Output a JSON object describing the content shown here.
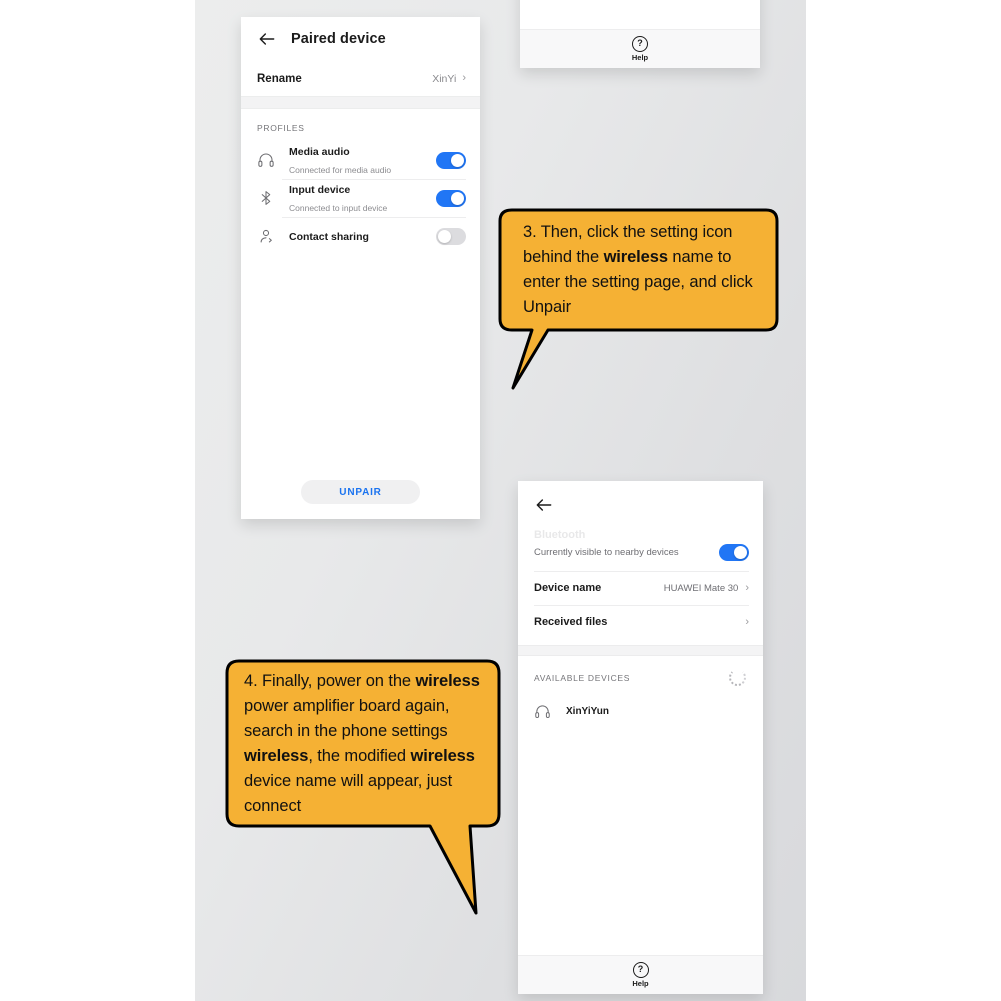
{
  "canvas": {
    "background_start": "#eceded",
    "background_end": "#d8d9dc"
  },
  "phone_paired_device": {
    "header": {
      "back_icon": "arrow-left-icon",
      "title": "Paired device"
    },
    "rename": {
      "label": "Rename",
      "value": "XinYi",
      "chevron": "›"
    },
    "profiles": {
      "section_title": "PROFILES",
      "rows": [
        {
          "icon": "headphones-icon",
          "title": "Media audio",
          "subtitle": "Connected for media audio",
          "toggle": "on"
        },
        {
          "icon": "bluetooth-icon",
          "title": "Input device",
          "subtitle": "Connected to input device",
          "toggle": "on"
        },
        {
          "icon": "contact-icon",
          "title": "Contact sharing",
          "subtitle": "",
          "toggle": "off"
        }
      ]
    },
    "unpair_button": {
      "label": "UNPAIR",
      "text_color": "#1a73f0",
      "background": "#f0f0f1"
    },
    "toggle_on_color": "#2176f5",
    "toggle_off_color": "#dcdcdf"
  },
  "phone_top_fragment": {
    "help": {
      "icon": "question-circle-icon",
      "glyph": "?",
      "label": "Help"
    }
  },
  "phone_bluetooth": {
    "header": {
      "back_icon": "arrow-left-icon"
    },
    "ghost_title": "Bluetooth",
    "visible_row": {
      "label": "Currently visible to nearby devices",
      "toggle": "on"
    },
    "rows": [
      {
        "label": "Device name",
        "value": "HUAWEI Mate 30",
        "chevron": "›"
      },
      {
        "label": "Received files",
        "value": "",
        "chevron": "›"
      }
    ],
    "available": {
      "section_title": "AVAILABLE DEVICES",
      "spinner": "loading-spinner-icon",
      "devices": [
        {
          "icon": "headphones-icon",
          "name": "XinYiYun"
        }
      ]
    },
    "help": {
      "icon": "question-circle-icon",
      "glyph": "?",
      "label": "Help"
    }
  },
  "callouts": {
    "fill": "#F5B134",
    "stroke": "#000000",
    "step3": {
      "line1_a": "3. Then, click the setting icon",
      "line2_a": "behind the ",
      "line2_b": "wireless",
      "line2_c": " name to",
      "line3_a": "enter the setting page, and click",
      "line4_a": "Unpair"
    },
    "step4": {
      "line1_a": "4. Finally, power on the ",
      "line1_b": "wireless",
      "line2_a": "power amplifier board again,",
      "line3_a": "search in the phone settings",
      "line4_a": "wireless",
      "line4_b": ", the modified ",
      "line4_c": "wireless",
      "line5_a": "device name will appear, just",
      "line6_a": "connect"
    }
  }
}
